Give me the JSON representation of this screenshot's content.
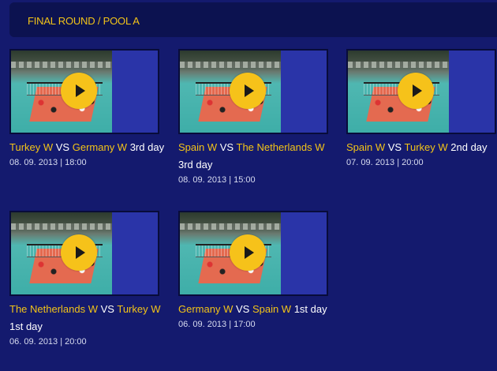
{
  "header": {
    "title": "FINAL ROUND / POOL A"
  },
  "colors": {
    "background": "#141a6e",
    "header_bg": "#0c1250",
    "accent": "#f2c318",
    "play_button": "#f6c21a"
  },
  "videos": [
    {
      "team1": "Turkey W",
      "vs": "VS",
      "team2": "Germany W",
      "suffix": "3rd day",
      "date": "08. 09. 2013 | 18:00"
    },
    {
      "team1": "Spain W",
      "vs": "VS",
      "team2": "The Netherlands W",
      "suffix": "3rd day",
      "date": "08. 09. 2013 | 15:00"
    },
    {
      "team1": "Spain W",
      "vs": "VS",
      "team2": "Turkey W",
      "suffix": "2nd day",
      "date": "07. 09. 2013 | 20:00"
    },
    {
      "team1": "The Netherlands W",
      "vs": "VS",
      "team2": "Turkey W",
      "suffix": "1st day",
      "date": "06. 09. 2013 | 20:00"
    },
    {
      "team1": "Germany W",
      "vs": "VS",
      "team2": "Spain W",
      "suffix": "1st day",
      "date": "06. 09. 2013 | 17:00"
    }
  ]
}
